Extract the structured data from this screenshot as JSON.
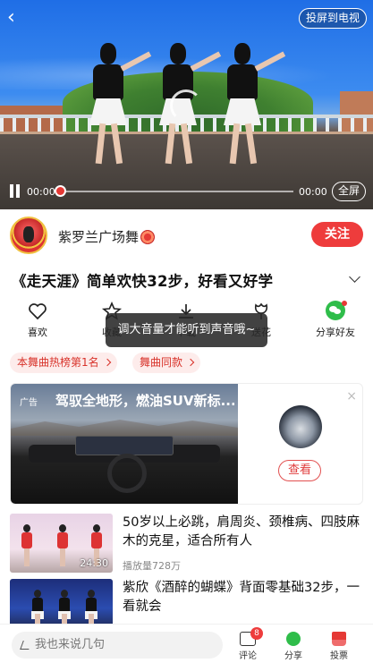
{
  "video": {
    "cast_label": "投屏到电视",
    "current_time": "00:00",
    "total_time": "00:00",
    "fullscreen_label": "全屏",
    "progress": 0
  },
  "author": {
    "name": "紫罗兰广场舞",
    "follow_label": "关注"
  },
  "title": "《走天涯》简单欢快32步，好看又好学",
  "actions": [
    {
      "label": "喜欢",
      "icon": "heart-icon"
    },
    {
      "label": "收藏",
      "icon": "star-icon"
    },
    {
      "label": "下载",
      "icon": "download-icon"
    },
    {
      "label": "送花",
      "icon": "flower-icon"
    },
    {
      "label": "分享好友",
      "icon": "wechat-icon"
    }
  ],
  "toast": "调大音量才能听到声音哦~",
  "tags": [
    "本舞曲热榜第1名",
    "舞曲同款"
  ],
  "ad": {
    "badge": "广告",
    "title": "驾驭全地形，燃油SUV新标...",
    "cta": "查看",
    "close": "×"
  },
  "videos": [
    {
      "title": "50岁以上必跳，肩周炎、颈椎病、四肢麻木的克星，适合所有人",
      "duration": "24:30",
      "meta": "播放量728万"
    },
    {
      "title": "紫欣《酒醉的蝴蝶》背面零基础32步，一看就会",
      "duration": "",
      "meta": ""
    }
  ],
  "bottom": {
    "comment_placeholder": "我也来说几句",
    "comment_label": "评论",
    "comment_count": "8",
    "share_label": "分享",
    "vote_label": "投票"
  },
  "colors": {
    "accent": "#EE3C3C",
    "wechat": "#2FBD4A",
    "tag_bg": "#FDECEB"
  }
}
